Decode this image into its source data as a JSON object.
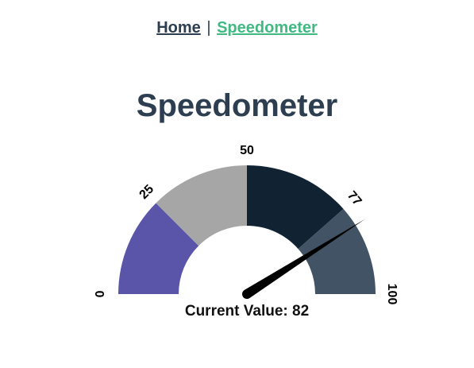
{
  "nav": {
    "home_label": "Home",
    "separator": "|",
    "speedometer_label": "Speedometer",
    "active_color": "#42b983",
    "link_color": "#2c3e50"
  },
  "page": {
    "title": "Speedometer"
  },
  "gauge": {
    "min": 0,
    "max": 100,
    "value": 82,
    "segments": [
      {
        "from": 0,
        "to": 25,
        "color": "#5a55a8"
      },
      {
        "from": 25,
        "to": 50,
        "color": "#a6a6a6"
      },
      {
        "from": 50,
        "to": 77,
        "color": "#112233"
      },
      {
        "from": 77,
        "to": 100,
        "color": "#415364"
      }
    ],
    "tick_labels": [
      "0",
      "25",
      "50",
      "77",
      "100"
    ],
    "needle_color": "#000000",
    "current_value_text": "Current Value: 82"
  }
}
